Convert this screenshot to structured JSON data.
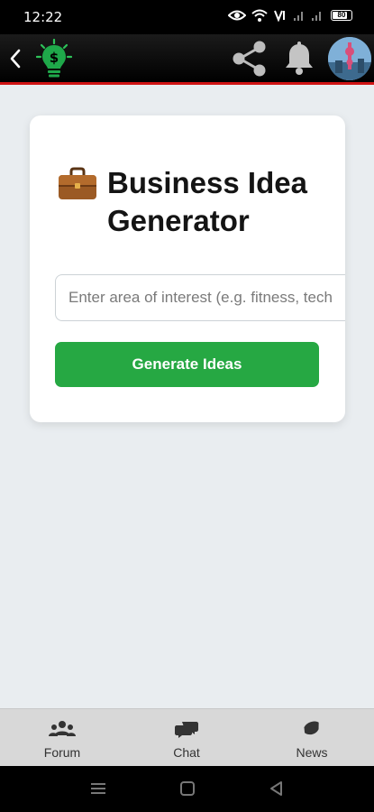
{
  "status_bar": {
    "time": "12:22",
    "battery": "80",
    "battery_level": 0.8
  },
  "app_bar": {
    "icons": [
      "back-arrow-icon",
      "lightbulb-dollar-logo",
      "share-icon",
      "bell-icon",
      "avatar"
    ],
    "colors": {
      "accent_border": "#d01414",
      "logo_green": "#1fa84a"
    }
  },
  "card": {
    "title_icon": "briefcase-emoji",
    "title": "Business Idea Generator",
    "input": {
      "value": "",
      "placeholder": "Enter area of interest (e.g. fitness, tech)"
    },
    "button_label": "Generate Ideas",
    "colors": {
      "button": "#26a843"
    }
  },
  "bottom_nav": {
    "items": [
      {
        "label": "Forum",
        "icon": "users-icon"
      },
      {
        "label": "Chat",
        "icon": "chat-bubbles-icon"
      },
      {
        "label": "News",
        "icon": "news-icon"
      }
    ]
  },
  "system_nav": {
    "icons": [
      "menu-icon",
      "home-icon",
      "back-triangle-icon"
    ]
  }
}
